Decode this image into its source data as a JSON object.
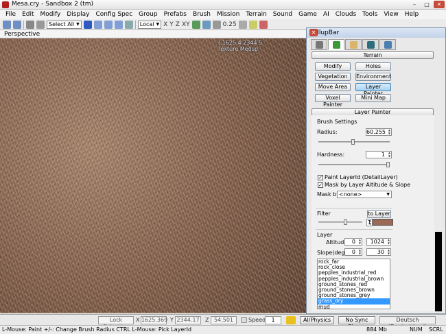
{
  "window": {
    "title": "Mesa.cry - Sandbox 2 (tm)",
    "min": "–",
    "max": "□",
    "close": "✕"
  },
  "menu": [
    "File",
    "Edit",
    "Modify",
    "Display",
    "Config Spec",
    "Group",
    "Prefabs",
    "Brush",
    "Mission",
    "Terrain",
    "Sound",
    "Game",
    "AI",
    "Clouds",
    "Tools",
    "View",
    "Help"
  ],
  "toolbar": {
    "selection": "Select All",
    "coord_system": "Local",
    "axes": [
      "X",
      "Y",
      "Z",
      "XY"
    ],
    "snap_value": "0.25"
  },
  "viewport": {
    "label": "Perspective",
    "overlay_lines": [
      "  ( 1625.4 2344 5",
      "  Texture Medsp"
    ]
  },
  "rollup": {
    "title": "RollupBar",
    "close": "✕",
    "tab_icons": [
      "objects-tab-icon",
      "terrain-tab-icon",
      "modeling-tab-icon",
      "display-tab-icon",
      "layers-tab-icon"
    ],
    "terrain_section": "Terrain",
    "terrain_buttons": [
      "Modify",
      "Holes",
      "Vegetation",
      "Environment",
      "Move Area",
      "Layer Painter",
      "Voxel Painter",
      "Mini Map"
    ],
    "layer_painter_section": "Layer Painter",
    "brush_settings": {
      "heading": "Brush Settings",
      "radius_label": "Radius:",
      "radius_value": "60.255",
      "radius_fraction": 0.48,
      "hardness_label": "Hardness:",
      "hardness_value": "1",
      "hardness_fraction": 1.0,
      "paint_layerid_label": "Paint LayerId (DetailLayer)",
      "paint_layerid_checked": true,
      "mask_altitude_label": "Mask by Layer Altitude & Slope",
      "mask_altitude_checked": true,
      "mask_by_label": "Mask by",
      "mask_by_value": "<none>"
    },
    "filter": {
      "heading": "Filter",
      "to_layer_label": "to Layer",
      "filter_value": "1",
      "filter_fraction": 0.62,
      "swatch_color": "#9a6a54"
    },
    "layer": {
      "heading": "Layer",
      "altitude_label": "Altitude",
      "altitude_min": "0",
      "altitude_max": "1024",
      "slope_label": "Slope(deg.)",
      "slope_min": "0",
      "slope_max": "30",
      "list": [
        "rock_far",
        "rock_close",
        "pepples_industrial_red",
        "pepples_industrial_brown",
        "ground_stones_red",
        "ground_stones_brown",
        "ground_stones_grey",
        "grass_dry",
        "mud"
      ],
      "selected_index": 7
    }
  },
  "bottom_bar": {
    "lock_selection": "Lock Selection",
    "x_label": "X",
    "x_value": "1625.369",
    "y_label": "Y",
    "y_value": "2344.17",
    "z_label": "Z",
    "z_value": "54.501",
    "speed_label": "Speed:",
    "speed_value": "1",
    "ai_physics": "AI/Physics",
    "no_sync_player": "No Sync Player",
    "language": "Deutsch (Deutschland)"
  },
  "status_bar": {
    "hint": "L-Mouse: Paint   +/-: Change Brush Radius   CTRL L-Mouse: Pick LayerId",
    "memory": "884 Mb",
    "num": "NUM",
    "scrl": "SCRL"
  }
}
